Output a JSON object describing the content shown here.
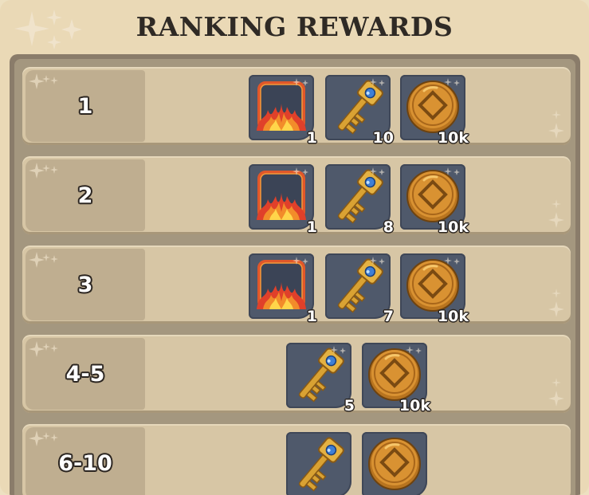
{
  "header": {
    "title": "RANKING REWARDS"
  },
  "colors": {
    "panel": "#ead9b6",
    "row": "#d7c6a5",
    "tile": "#4f596b",
    "coin": "#c98a2a"
  },
  "rows": [
    {
      "rank": "1",
      "rewards": [
        {
          "item": "flame-frame-icon",
          "qty": "1"
        },
        {
          "item": "golden-key-icon",
          "qty": "10"
        },
        {
          "item": "gold-coin-icon",
          "qty": "10k"
        }
      ]
    },
    {
      "rank": "2",
      "rewards": [
        {
          "item": "flame-frame-icon",
          "qty": "1"
        },
        {
          "item": "golden-key-icon",
          "qty": "8"
        },
        {
          "item": "gold-coin-icon",
          "qty": "10k"
        }
      ]
    },
    {
      "rank": "3",
      "rewards": [
        {
          "item": "flame-frame-icon",
          "qty": "1"
        },
        {
          "item": "golden-key-icon",
          "qty": "7"
        },
        {
          "item": "gold-coin-icon",
          "qty": "10k"
        }
      ]
    },
    {
      "rank": "4-5",
      "rewards": [
        {
          "item": "golden-key-icon",
          "qty": "5"
        },
        {
          "item": "gold-coin-icon",
          "qty": "10k"
        }
      ]
    },
    {
      "rank": "6-10",
      "rewards": [
        {
          "item": "golden-key-icon",
          "qty": ""
        },
        {
          "item": "gold-coin-icon",
          "qty": ""
        }
      ]
    }
  ]
}
